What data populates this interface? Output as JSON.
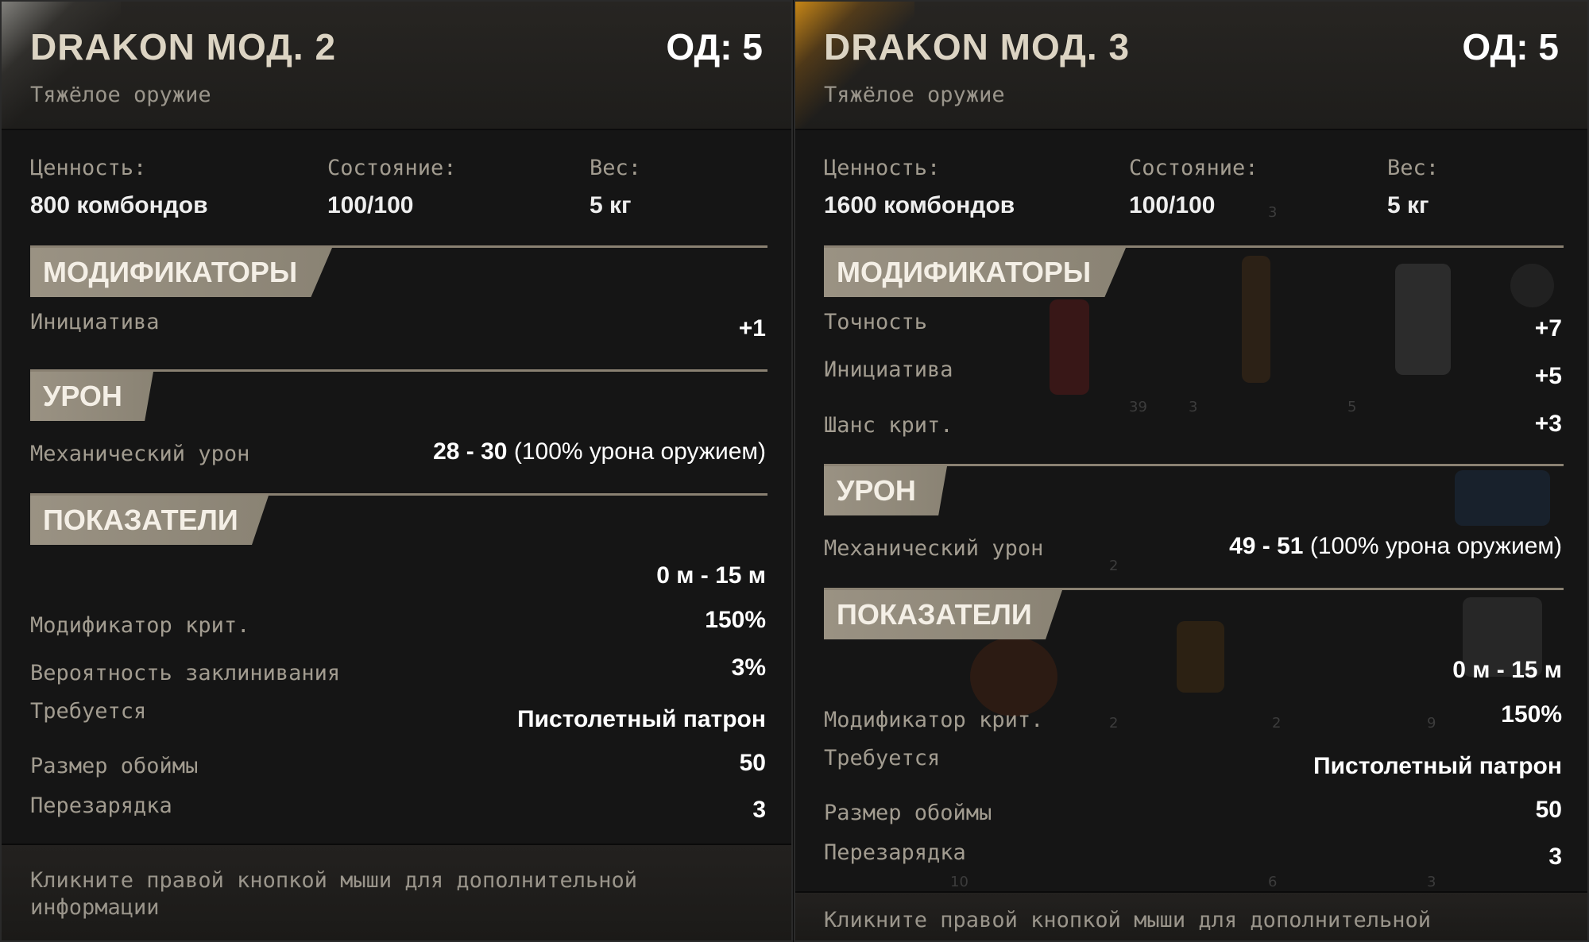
{
  "left": {
    "title": "DRAKON МОД. 2",
    "ap": "ОД: 5",
    "type": "Тяжёлое оружие",
    "stats": {
      "value_label": "Ценность:",
      "value": "800 комбондов",
      "condition_label": "Состояние:",
      "condition": "100/100",
      "weight_label": "Вес:",
      "weight": "5 кг"
    },
    "modifiers_title": "МОДИФИКАТОРЫ",
    "modifiers": [
      {
        "label": "Инициатива",
        "value": "+1"
      }
    ],
    "damage_title": "УРОН",
    "damage": {
      "label": "Механический урон",
      "range": "28 - 30",
      "suffix": "(100% урона оружием)"
    },
    "stats_title": "ПОКАЗАТЕЛИ",
    "range": "0 м - 15 м",
    "indicators": [
      {
        "label": "Модификатор крит.",
        "value": "150%"
      },
      {
        "label": "Вероятность заклинивания",
        "value": "3%"
      },
      {
        "label": "Требуется",
        "value": "Пистолетный патрон"
      },
      {
        "label": "Размер обоймы",
        "value": "50"
      },
      {
        "label": "Перезарядка",
        "value": "3"
      }
    ],
    "footer": "Кликните правой кнопкой мыши для дополнительной информации"
  },
  "right": {
    "title": "DRAKON МОД. 3",
    "ap": "ОД: 5",
    "type": "Тяжёлое оружие",
    "stats": {
      "value_label": "Ценность:",
      "value": "1600 комбондов",
      "condition_label": "Состояние:",
      "condition": "100/100",
      "weight_label": "Вес:",
      "weight": "5 кг"
    },
    "modifiers_title": "МОДИФИКАТОРЫ",
    "modifiers": [
      {
        "label": "Точность",
        "value": "+7"
      },
      {
        "label": "Инициатива",
        "value": "+5"
      },
      {
        "label": "Шанс крит.",
        "value": "+3"
      }
    ],
    "damage_title": "УРОН",
    "damage": {
      "label": "Механический урон",
      "range": "49 - 51",
      "suffix": "(100% урона оружием)"
    },
    "stats_title": "ПОКАЗАТЕЛИ",
    "range": "0 м - 15 м",
    "indicators": [
      {
        "label": "Модификатор крит.",
        "value": "150%"
      },
      {
        "label": "Требуется",
        "value": "Пистолетный патрон"
      },
      {
        "label": "Размер обоймы",
        "value": "50"
      },
      {
        "label": "Перезарядка",
        "value": "3"
      }
    ],
    "footer": "Кликните правой кнопкой мыши для дополнительной",
    "inventory_counts": [
      "3",
      "39",
      "3",
      "5",
      "2",
      "2",
      "2",
      "9",
      "10",
      "6",
      "3"
    ]
  },
  "colors": {
    "panel_bg": "#151515",
    "section_header": "#9a9283",
    "label_text": "#a29c90",
    "value_text": "#ffffff",
    "title_text": "#dcd4c3",
    "rarity_gold": "#e1961a"
  }
}
